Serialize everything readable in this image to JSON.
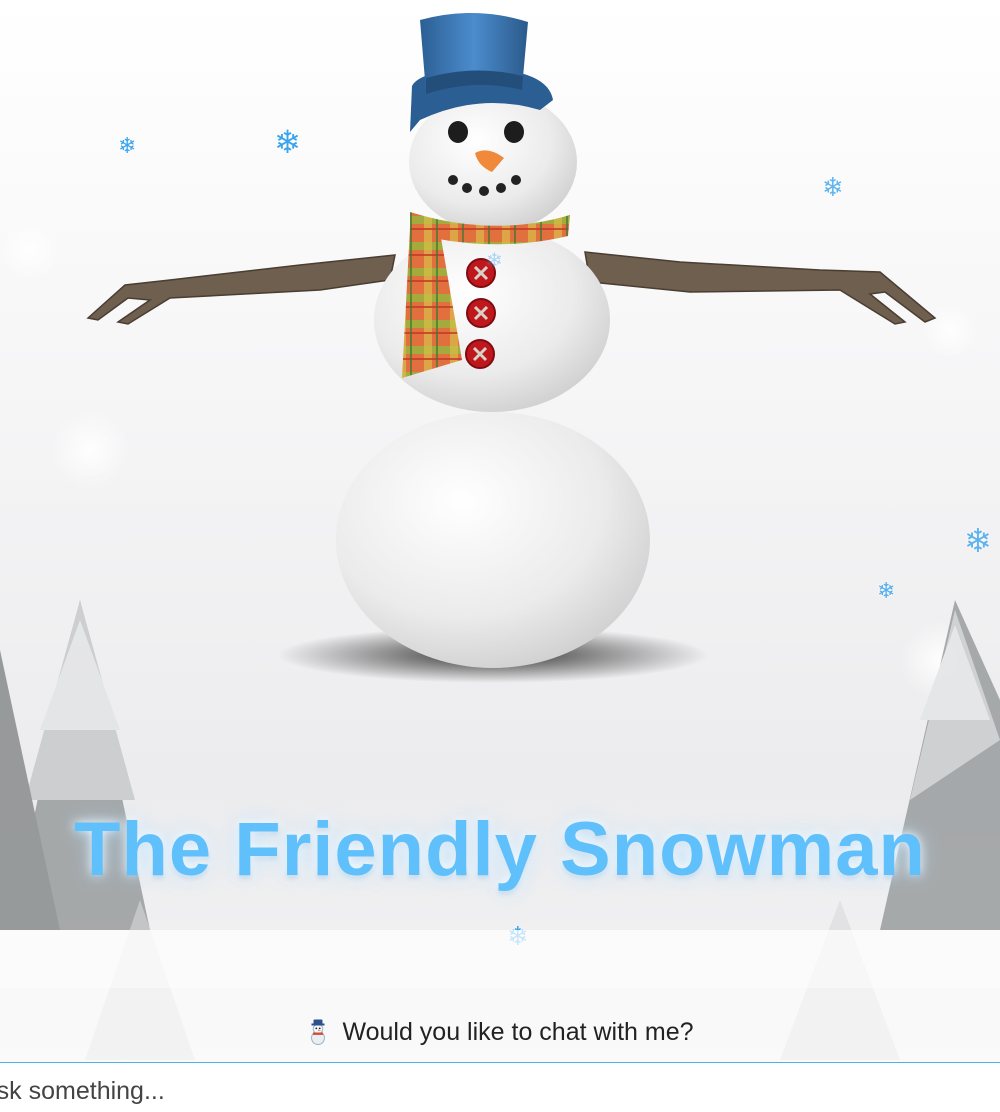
{
  "title": "The Friendly Snowman",
  "chat": {
    "prompt_icon": "snowman-icon",
    "prompt": "Would you like to chat with me?",
    "input_placeholder": "Ask something..."
  },
  "icons": {
    "snowflake": "❄"
  },
  "colors": {
    "title": "#5fc0fb",
    "accent_line": "#4bb6d8",
    "hat": "#3a78b5",
    "button_red": "#c0171d"
  }
}
